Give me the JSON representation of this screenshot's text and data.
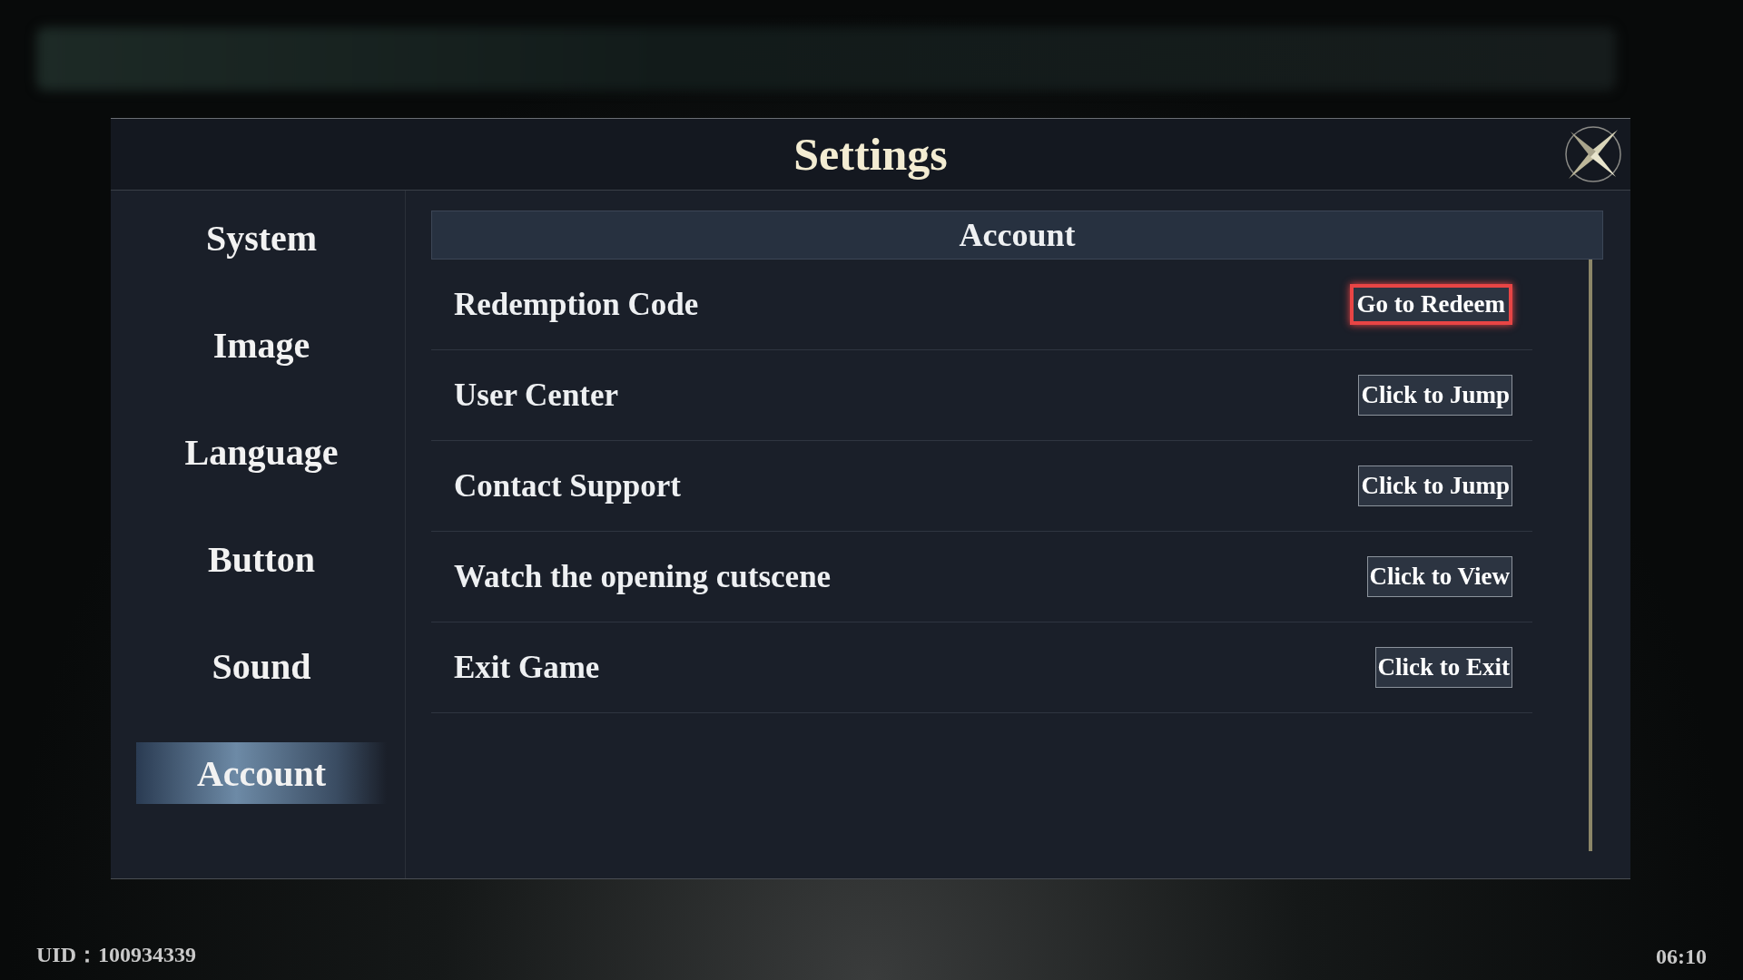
{
  "window": {
    "title": "Settings"
  },
  "sidebar": {
    "items": [
      {
        "label": "System",
        "selected": false
      },
      {
        "label": "Image",
        "selected": false
      },
      {
        "label": "Language",
        "selected": false
      },
      {
        "label": "Button",
        "selected": false
      },
      {
        "label": "Sound",
        "selected": false
      },
      {
        "label": "Account",
        "selected": true
      }
    ]
  },
  "section": {
    "title": "Account"
  },
  "rows": [
    {
      "label": "Redemption Code",
      "button": "Go to Redeem",
      "focused": true
    },
    {
      "label": "User Center",
      "button": "Click to Jump",
      "focused": false
    },
    {
      "label": "Contact Support",
      "button": "Click to Jump",
      "focused": false
    },
    {
      "label": "Watch the opening cutscene",
      "button": "Click to View",
      "focused": false
    },
    {
      "label": "Exit Game",
      "button": "Click to Exit",
      "focused": false
    }
  ],
  "status_bar": {
    "uid": "UID：100934339",
    "time": "06:10"
  }
}
